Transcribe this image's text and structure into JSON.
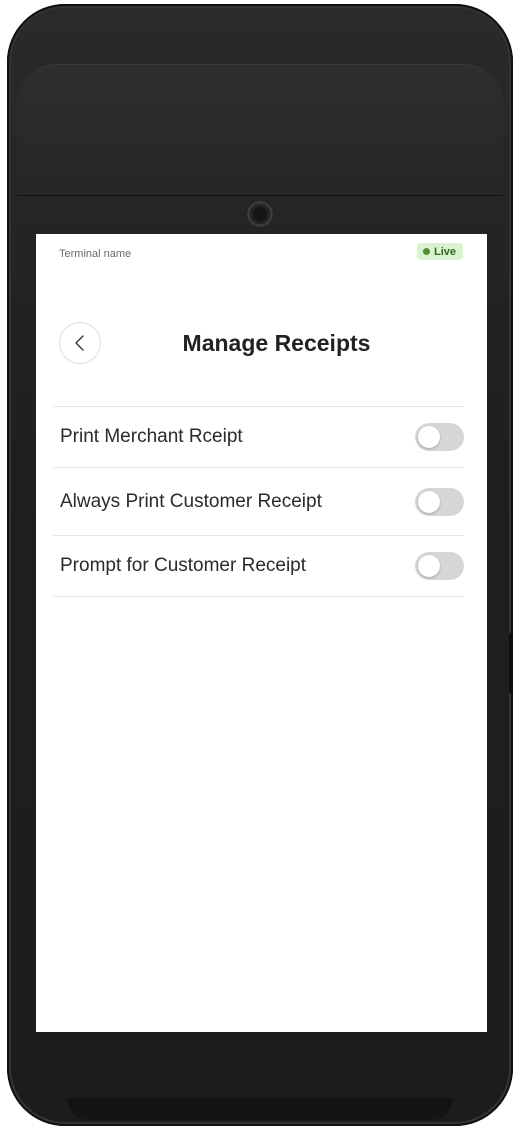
{
  "status_bar": {
    "terminal_name": "Terminal name",
    "live_badge": "Live",
    "live_color": "#4d8f35"
  },
  "header": {
    "back_icon": "chevron-left-icon",
    "title": "Manage Receipts"
  },
  "settings": [
    {
      "label": "Print Merchant Rceipt",
      "enabled": false
    },
    {
      "label": "Always Print Customer Receipt",
      "enabled": false
    },
    {
      "label": "Prompt for Customer Receipt",
      "enabled": false
    }
  ]
}
